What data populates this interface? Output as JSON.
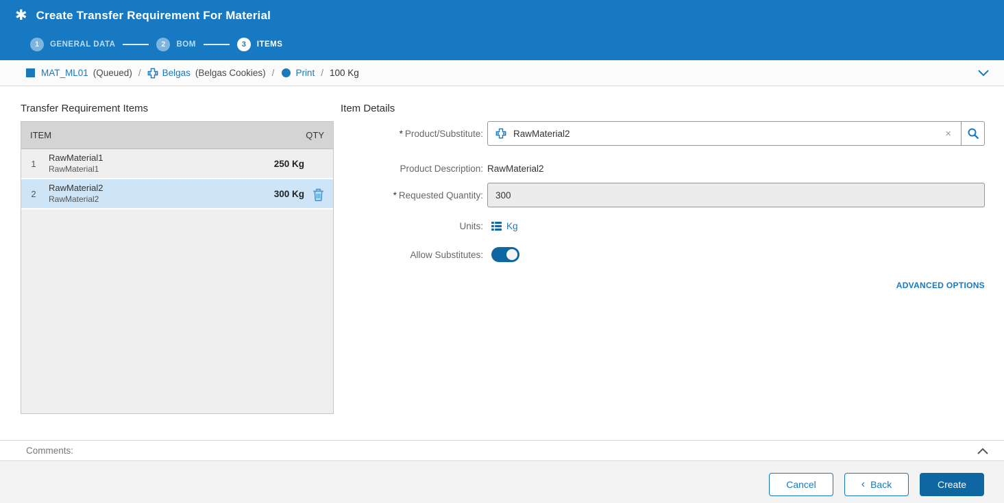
{
  "header": {
    "asterisk_icon": "✱",
    "title": "Create Transfer Requirement For Material",
    "steps": [
      {
        "number": "1",
        "label": "GENERAL DATA"
      },
      {
        "number": "2",
        "label": "BOM"
      },
      {
        "number": "3",
        "label": "ITEMS"
      }
    ]
  },
  "breadcrumb": {
    "material_link": "MAT_ML01",
    "material_status": "(Queued)",
    "sep": "/",
    "order_link": "Belgas",
    "order_desc": "(Belgas Cookies)",
    "step_link": "Print",
    "quantity": "100 Kg"
  },
  "items_panel": {
    "title": "Transfer Requirement Items",
    "columns": {
      "item": "ITEM",
      "qty": "QTY"
    },
    "rows": [
      {
        "index": "1",
        "name": "RawMaterial1",
        "description": "RawMaterial1",
        "qty": "250 Kg"
      },
      {
        "index": "2",
        "name": "RawMaterial2",
        "description": "RawMaterial2",
        "qty": "300 Kg"
      }
    ]
  },
  "details_panel": {
    "title": "Item Details",
    "required_marker": "*",
    "product_label": "Product/Substitute:",
    "product_value": "RawMaterial2",
    "clear_icon": "×",
    "description_label": "Product Description:",
    "description_value": "RawMaterial2",
    "quantity_label": "Requested Quantity:",
    "quantity_value": "300",
    "units_label": "Units:",
    "units_value": "Kg",
    "allow_label": "Allow Substitutes:",
    "allow_state": "on",
    "advanced_link": "ADVANCED OPTIONS"
  },
  "comments": {
    "label": "Comments:"
  },
  "footer": {
    "cancel_label": "Cancel",
    "back_chevron": "‹",
    "back_label": "Back",
    "create_label": "Create"
  },
  "colors": {
    "header_blue": "#1779c1",
    "link_blue": "#1b78ba",
    "primary_dark_blue": "#0f67a1",
    "selected_row": "#cde5f6",
    "table_gray": "#efefef",
    "table_header_gray": "#d4d4d4"
  }
}
